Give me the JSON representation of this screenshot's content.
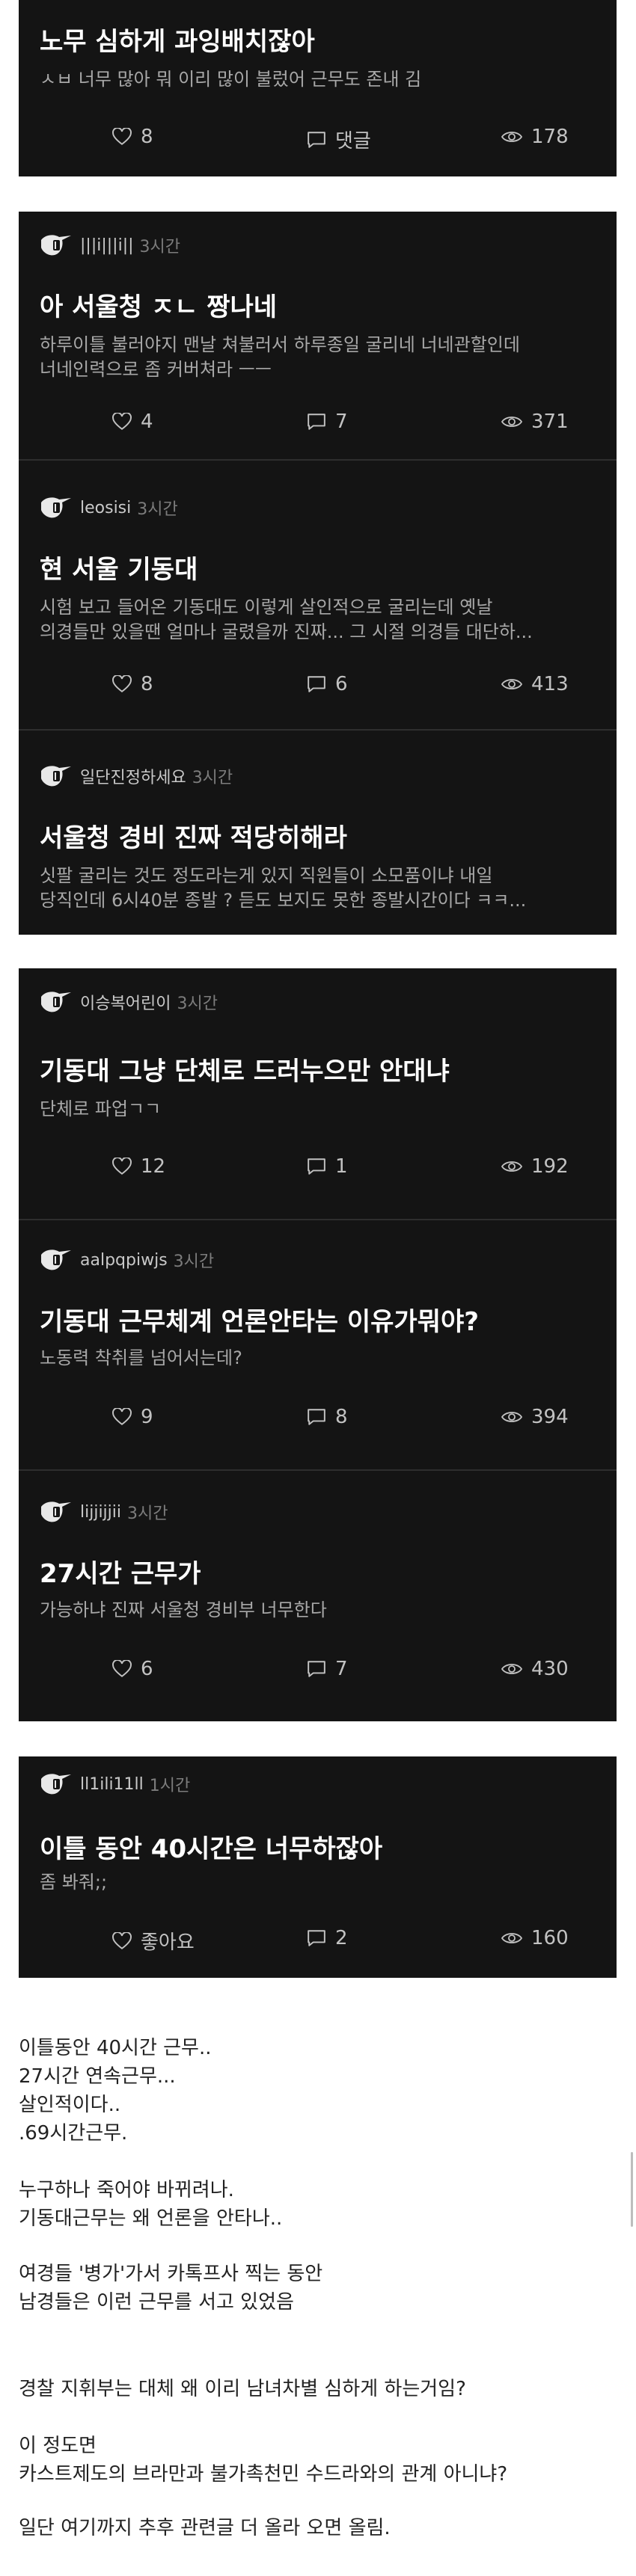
{
  "theme": {
    "card_bg": "#141414",
    "divider": "#2e2e2e",
    "title_color": "#ffffff",
    "muted": "#a8a8a8"
  },
  "posts": [
    {
      "title": "노무 심하게 과잉배치잖아",
      "body": "ㅅㅂ 너무 많아  뭐 이리 많이 불렀어  근무도 존내 김",
      "likes": "8",
      "comments": "댓글",
      "views": "178"
    },
    {
      "author": "|||i|||i||",
      "ago": "3시간",
      "title": "아 서울청 ㅈㄴ 짱나네",
      "body1": "하루이틀 불러야지 맨날 쳐불러서 하루종일 굴리네  너네관할인데",
      "body2": "너네인력으로 좀 커버쳐라 ㅡㅡ",
      "likes": "4",
      "comments": "7",
      "views": "371"
    },
    {
      "author": "leosisi",
      "ago": "3시간",
      "title": "현 서울 기동대",
      "body1": "시험 보고 들어온 기동대도 이렇게 살인적으로 굴리는데 옛날",
      "body2": "의경들만 있을땐 얼마나 굴렸을까 진짜... 그 시절 의경들 대단하...",
      "likes": "8",
      "comments": "6",
      "views": "413"
    },
    {
      "author": "일단진정하세요",
      "ago": "3시간",
      "title": "서울청 경비 진짜 적당히해라",
      "body1": "싯팔 굴리는 것도 정도라는게 있지 직원들이 소모품이냐 내일",
      "body2": "당직인데 6시40분 종발 ? 듣도 보지도 못한 종발시간이다 ㅋㅋ..."
    },
    {
      "author": "이승복어린이",
      "ago": "3시간",
      "title": "기동대 그냥 단체로 드러누으만 안대냐",
      "body": "단체로 파업ㄱㄱ",
      "likes": "12",
      "comments": "1",
      "views": "192"
    },
    {
      "author": "aalpqpiwjs",
      "ago": "3시간",
      "title": "기동대 근무체계 언론안타는 이유가뭐야?",
      "body": "노동력 착취를 넘어서는데?",
      "likes": "9",
      "comments": "8",
      "views": "394"
    },
    {
      "author": "lijjijjii",
      "ago": "3시간",
      "title": "27시간 근무가",
      "body": "가능하냐 진짜 서울청 경비부 너무한다",
      "likes": "6",
      "comments": "7",
      "views": "430"
    },
    {
      "author": "ll1ili11ll",
      "ago": "1시간",
      "title": "이틀 동안 40시간은 너무하잖아",
      "body": "좀 봐줘;;",
      "likes": "좋아요",
      "comments": "2",
      "views": "160"
    }
  ],
  "article": {
    "l1": "이틀동안 40시간 근무..",
    "l2": "27시간 연속근무...",
    "l3": "살인적이다..",
    "l4": ".69시간근무.",
    "l5": "누구하나 죽어야 바뀌려나.",
    "l6": "기동대근무는 왜 언론을 안타나..",
    "l7": "여경들 '병가'가서 카톡프사 찍는 동안",
    "l8": "남경들은 이런 근무를 서고 있었음",
    "l9": "경찰 지휘부는 대체 왜 이리 남녀차별 심하게 하는거임?",
    "l10": "이 정도면",
    "l11": "카스트제도의 브라만과 불가촉천민 수드라와의 관계 아니냐?",
    "l12": "일단 여기까지 추후 관련글 더 올라 오면 올림."
  }
}
